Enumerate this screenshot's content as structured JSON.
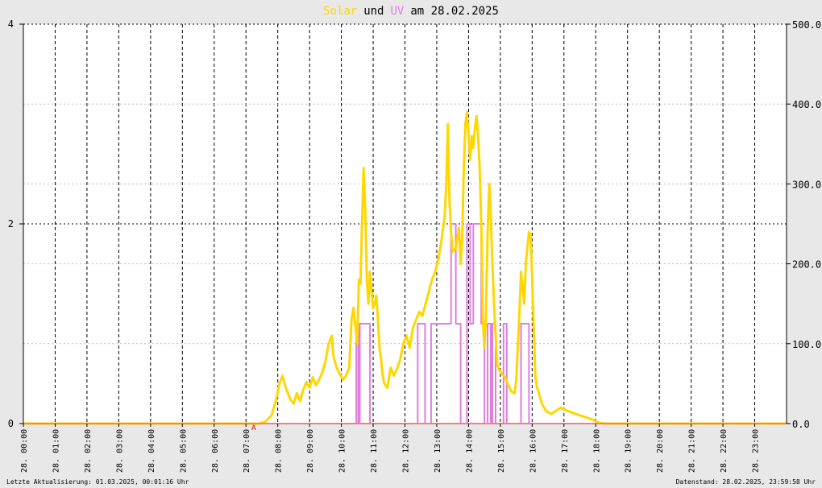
{
  "colors": {
    "solar": "#ffd700",
    "uv": "#e07ee0",
    "zero_line": "#f08080",
    "marker": "#cc0000",
    "background": "#ffffff",
    "page": "#e8e8e8",
    "grid_major": "#000000",
    "grid_minor": "#bbbbbb",
    "text": "#000000"
  },
  "chart_data": {
    "type": "line",
    "title": {
      "solar_word": "Solar",
      "und": "und",
      "uv_word": "UV",
      "rest": "am 28.02.2025"
    },
    "left_axis": {
      "ylim": [
        0,
        4
      ],
      "ticks": [
        "0",
        "2",
        "4"
      ],
      "gridlines": [
        1,
        2,
        3
      ]
    },
    "right_axis": {
      "ylim": [
        0,
        500
      ],
      "ticks": [
        "0.0",
        "100.0",
        "200.0",
        "300.0",
        "400.0",
        "500.0"
      ]
    },
    "x_axis": {
      "xlim": [
        0,
        24
      ],
      "tick_hours": [
        0,
        1,
        2,
        3,
        4,
        5,
        6,
        7,
        8,
        9,
        10,
        11,
        12,
        13,
        14,
        15,
        16,
        17,
        18,
        19,
        20,
        21,
        22,
        23
      ],
      "tick_labels": [
        "28. 00:00",
        "28. 01:00",
        "28. 02:00",
        "28. 03:00",
        "28. 04:00",
        "28. 05:00",
        "28. 06:00",
        "28. 07:00",
        "28. 08:00",
        "28. 09:00",
        "28. 10:00",
        "28. 11:00",
        "28. 12:00",
        "28. 13:00",
        "28. 14:00",
        "28. 15:00",
        "28. 16:00",
        "28. 17:00",
        "28. 18:00",
        "28. 19:00",
        "28. 20:00",
        "28. 21:00",
        "28. 22:00",
        "28. 23:00"
      ]
    },
    "marker_label": "A",
    "marker_hour": 7.1,
    "series": [
      {
        "id": "solar",
        "axis": "right",
        "points": [
          [
            0,
            0
          ],
          [
            7.2,
            0
          ],
          [
            7.4,
            0
          ],
          [
            7.6,
            2
          ],
          [
            7.8,
            10
          ],
          [
            7.95,
            30
          ],
          [
            8.05,
            50
          ],
          [
            8.15,
            60
          ],
          [
            8.25,
            45
          ],
          [
            8.4,
            30
          ],
          [
            8.5,
            25
          ],
          [
            8.6,
            38
          ],
          [
            8.7,
            28
          ],
          [
            8.8,
            42
          ],
          [
            8.9,
            52
          ],
          [
            9.0,
            45
          ],
          [
            9.1,
            58
          ],
          [
            9.2,
            48
          ],
          [
            9.3,
            55
          ],
          [
            9.4,
            64
          ],
          [
            9.5,
            78
          ],
          [
            9.6,
            100
          ],
          [
            9.7,
            110
          ],
          [
            9.75,
            85
          ],
          [
            9.85,
            70
          ],
          [
            9.95,
            62
          ],
          [
            10.05,
            55
          ],
          [
            10.15,
            60
          ],
          [
            10.25,
            70
          ],
          [
            10.32,
            130
          ],
          [
            10.38,
            145
          ],
          [
            10.45,
            120
          ],
          [
            10.5,
            100
          ],
          [
            10.55,
            180
          ],
          [
            10.6,
            175
          ],
          [
            10.65,
            250
          ],
          [
            10.7,
            320
          ],
          [
            10.75,
            270
          ],
          [
            10.8,
            180
          ],
          [
            10.85,
            150
          ],
          [
            10.9,
            190
          ],
          [
            10.95,
            165
          ],
          [
            11.0,
            145
          ],
          [
            11.05,
            150
          ],
          [
            11.1,
            160
          ],
          [
            11.15,
            130
          ],
          [
            11.2,
            95
          ],
          [
            11.25,
            80
          ],
          [
            11.3,
            60
          ],
          [
            11.35,
            50
          ],
          [
            11.45,
            45
          ],
          [
            11.55,
            70
          ],
          [
            11.65,
            60
          ],
          [
            11.75,
            68
          ],
          [
            11.85,
            80
          ],
          [
            11.95,
            100
          ],
          [
            12.05,
            110
          ],
          [
            12.15,
            95
          ],
          [
            12.25,
            120
          ],
          [
            12.35,
            130
          ],
          [
            12.45,
            140
          ],
          [
            12.55,
            135
          ],
          [
            12.65,
            150
          ],
          [
            12.75,
            165
          ],
          [
            12.85,
            180
          ],
          [
            12.95,
            190
          ],
          [
            13.05,
            205
          ],
          [
            13.15,
            230
          ],
          [
            13.25,
            260
          ],
          [
            13.3,
            300
          ],
          [
            13.35,
            375
          ],
          [
            13.4,
            280
          ],
          [
            13.45,
            240
          ],
          [
            13.5,
            215
          ],
          [
            13.6,
            220
          ],
          [
            13.7,
            245
          ],
          [
            13.75,
            200
          ],
          [
            13.8,
            230
          ],
          [
            13.85,
            320
          ],
          [
            13.9,
            375
          ],
          [
            13.95,
            390
          ],
          [
            14.0,
            360
          ],
          [
            14.05,
            330
          ],
          [
            14.1,
            360
          ],
          [
            14.15,
            345
          ],
          [
            14.2,
            370
          ],
          [
            14.25,
            385
          ],
          [
            14.3,
            360
          ],
          [
            14.35,
            320
          ],
          [
            14.4,
            250
          ],
          [
            14.45,
            130
          ],
          [
            14.5,
            95
          ],
          [
            14.55,
            140
          ],
          [
            14.6,
            240
          ],
          [
            14.65,
            300
          ],
          [
            14.7,
            260
          ],
          [
            14.75,
            200
          ],
          [
            14.8,
            150
          ],
          [
            14.85,
            110
          ],
          [
            14.9,
            75
          ],
          [
            14.95,
            68
          ],
          [
            15.05,
            62
          ],
          [
            15.15,
            58
          ],
          [
            15.25,
            48
          ],
          [
            15.35,
            40
          ],
          [
            15.45,
            38
          ],
          [
            15.5,
            55
          ],
          [
            15.6,
            140
          ],
          [
            15.65,
            190
          ],
          [
            15.7,
            170
          ],
          [
            15.75,
            150
          ],
          [
            15.8,
            200
          ],
          [
            15.9,
            240
          ],
          [
            15.95,
            235
          ],
          [
            16.0,
            185
          ],
          [
            16.05,
            120
          ],
          [
            16.1,
            60
          ],
          [
            16.15,
            45
          ],
          [
            16.2,
            40
          ],
          [
            16.3,
            25
          ],
          [
            16.45,
            15
          ],
          [
            16.6,
            12
          ],
          [
            16.75,
            16
          ],
          [
            16.9,
            20
          ],
          [
            17.1,
            16
          ],
          [
            17.3,
            13
          ],
          [
            17.6,
            9
          ],
          [
            17.9,
            5
          ],
          [
            18.1,
            1
          ],
          [
            18.25,
            0
          ],
          [
            24,
            0
          ]
        ]
      },
      {
        "id": "uv",
        "axis": "left",
        "points": [
          [
            0,
            0
          ],
          [
            10.47,
            0
          ],
          [
            10.47,
            1
          ],
          [
            10.53,
            1
          ],
          [
            10.53,
            0
          ],
          [
            10.58,
            0
          ],
          [
            10.58,
            1
          ],
          [
            10.9,
            1
          ],
          [
            10.9,
            0
          ],
          [
            12.4,
            0
          ],
          [
            12.4,
            1
          ],
          [
            12.63,
            1
          ],
          [
            12.63,
            0
          ],
          [
            12.82,
            0
          ],
          [
            12.82,
            1
          ],
          [
            13.45,
            1
          ],
          [
            13.45,
            2
          ],
          [
            13.6,
            2
          ],
          [
            13.6,
            1
          ],
          [
            13.75,
            1
          ],
          [
            13.75,
            0
          ],
          [
            13.95,
            0
          ],
          [
            13.95,
            2
          ],
          [
            14.05,
            2
          ],
          [
            14.05,
            1
          ],
          [
            14.15,
            1
          ],
          [
            14.15,
            2
          ],
          [
            14.4,
            2
          ],
          [
            14.4,
            1
          ],
          [
            14.5,
            1
          ],
          [
            14.5,
            0
          ],
          [
            14.6,
            0
          ],
          [
            14.6,
            1
          ],
          [
            14.7,
            1
          ],
          [
            14.7,
            0
          ],
          [
            14.75,
            0
          ],
          [
            14.75,
            1
          ],
          [
            14.85,
            1
          ],
          [
            14.85,
            0
          ],
          [
            15.1,
            0
          ],
          [
            15.1,
            1
          ],
          [
            15.2,
            1
          ],
          [
            15.2,
            0
          ],
          [
            15.65,
            0
          ],
          [
            15.65,
            1
          ],
          [
            15.9,
            1
          ],
          [
            15.9,
            0
          ],
          [
            24,
            0
          ]
        ]
      }
    ]
  },
  "footer": {
    "left": "Letzte Aktualisierung: 01.03.2025, 00:01:16 Uhr",
    "right": "Datenstand: 28.02.2025, 23:59:58 Uhr"
  }
}
